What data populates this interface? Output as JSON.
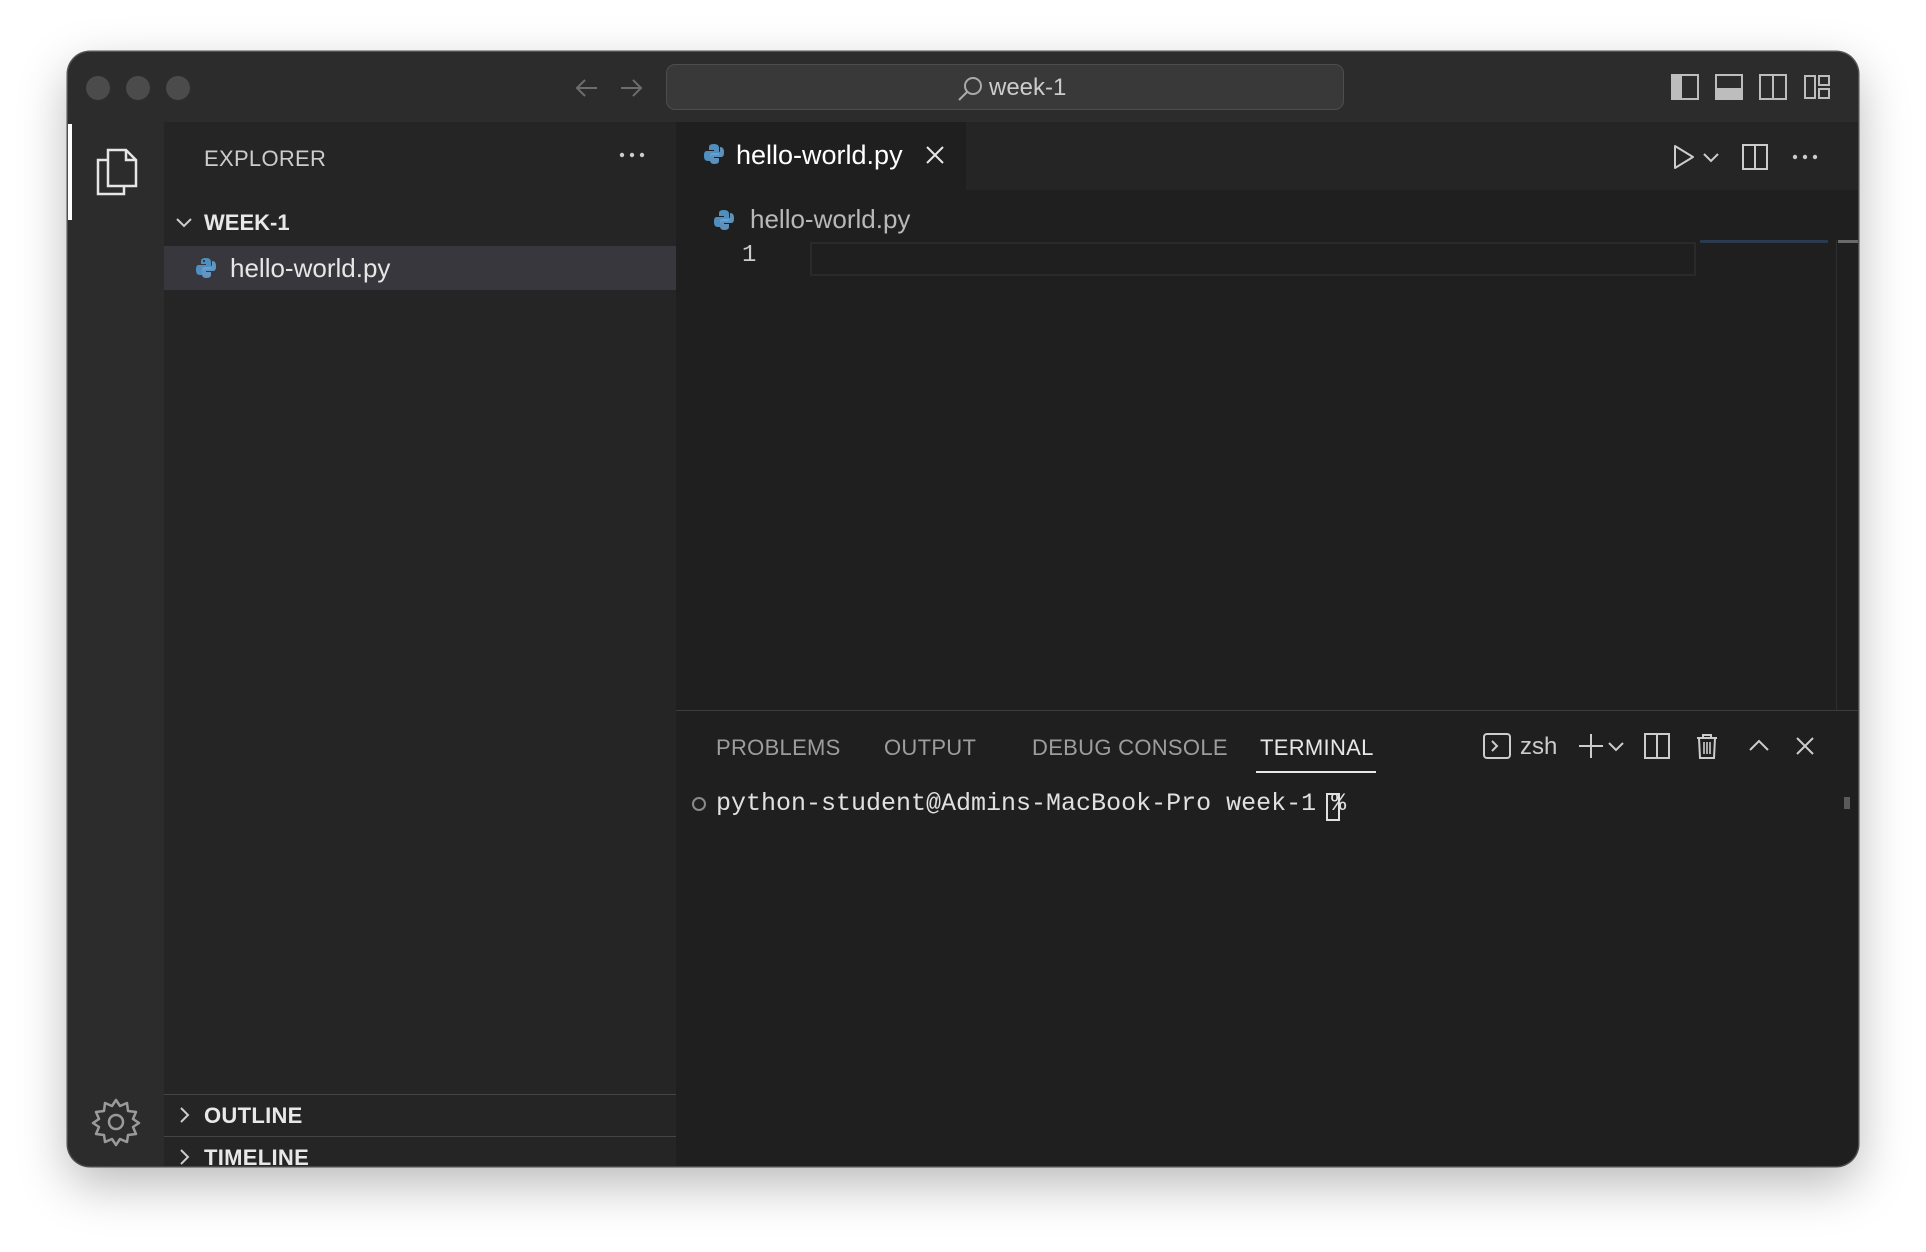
{
  "window": {
    "search_label": "week-1"
  },
  "sidebar": {
    "title": "EXPLORER",
    "folder": "WEEK-1",
    "files": [
      {
        "name": "hello-world.py",
        "icon": "python-file-icon"
      }
    ],
    "sections": [
      "OUTLINE",
      "TIMELINE"
    ]
  },
  "editor": {
    "tab_label": "hello-world.py",
    "breadcrumb": "hello-world.py",
    "line_numbers": [
      "1"
    ]
  },
  "panel": {
    "tabs": [
      "PROBLEMS",
      "OUTPUT",
      "DEBUG CONSOLE",
      "TERMINAL"
    ],
    "active_tab": "TERMINAL",
    "terminal_shell": "zsh",
    "prompt": "python-student@Admins-MacBook-Pro week-1 %"
  },
  "colors": {
    "background": "#1f1f1f",
    "sidebar": "#252526",
    "titlebar": "#2c2c2c",
    "python_icon": "#4f8fc0"
  }
}
